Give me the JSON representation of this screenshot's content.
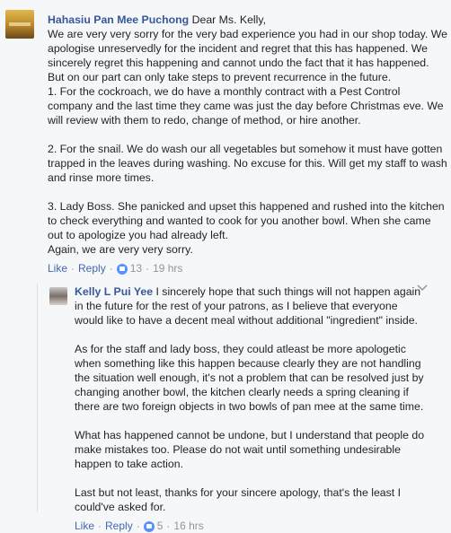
{
  "comment1": {
    "author": "Hahasiu Pan Mee Puchong",
    "text_first": "Dear Ms. Kelly,",
    "text_rest": "We are very very sorry for the very bad experience you had in our shop today. We apologise unreservedly for the incident and regret that this has happened. We sincerely regret this happening and cannot undo the fact that it has happened. But on our part can only take steps to prevent recurrence in the future.\n1. For the cockroach, we do have a monthly contract with a Pest Control company and the last time they came was just the day before Christmas eve. We will review with them to redo, change of method, or hire another.",
    "para2": "2. For the snail. We do wash our all vegetables but somehow it must have gotten trapped in the leaves during washing. No excuse for this. Will get my staff to wash and rinse more times.",
    "para3": "3. Lady Boss. She panicked and upset this happened and rushed into the kitchen to check everything and wanted to cook for you another bowl. When she came out to apologize you had already left.\nAgain, we are very very sorry.",
    "like_label": "Like",
    "reply_label": "Reply",
    "reaction_count": "13",
    "time": "19 hrs"
  },
  "comment2": {
    "author": "Kelly L Pui Yee",
    "para1": "I sincerely hope that such things will not happen again in the future for the rest of your patrons, as I believe that everyone would like to have a decent meal without additional \"ingredient\" inside.",
    "para2": "As for the staff and lady boss, they could atleast be more apologetic when something like this happen because clearly they are not handling the situation well enough, it's not a problem that can be resolved just by changing another bowl, the kitchen clearly needs a spring cleaning if there are two foreign objects in two bowls of pan mee at the same time.",
    "para3": "What has happened cannot be undone, but I understand that people do make mistakes too. Please do not wait until something undesirable happen to take action.",
    "para4": "Last but not least, thanks for your sincere apology, that's the least I could've asked for.",
    "like_label": "Like",
    "reply_label": "Reply",
    "reaction_count": "5",
    "time": "16 hrs"
  },
  "icons": {
    "like_reaction": "thumbs-up-icon",
    "options": "chevron-down-icon"
  },
  "colors": {
    "name": "#365899",
    "link": "#4267b2",
    "meta": "#90949c",
    "like_badge": "#5890ff",
    "background": "#f6f7f9"
  }
}
